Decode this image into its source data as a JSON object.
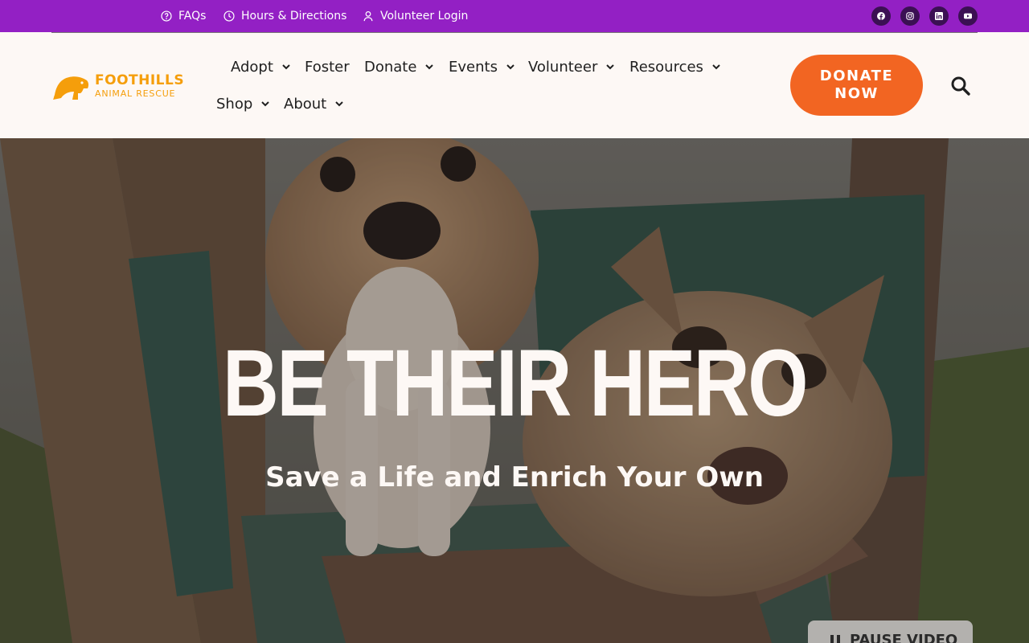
{
  "topbar": {
    "links": [
      {
        "label": "FAQs",
        "icon": "question-circle-icon"
      },
      {
        "label": "Hours & Directions",
        "icon": "clock-icon"
      },
      {
        "label": "Volunteer Login",
        "icon": "user-icon"
      }
    ],
    "social": [
      "facebook-icon",
      "instagram-icon",
      "linkedin-icon",
      "youtube-icon"
    ],
    "color": "#9320c4"
  },
  "logo": {
    "top": "FOOTHILLS",
    "bottom": "ANIMAL RESCUE",
    "color": "#f59e0b"
  },
  "nav": {
    "items": [
      {
        "label": "Adopt",
        "dropdown": true
      },
      {
        "label": "Foster",
        "dropdown": false
      },
      {
        "label": "Donate",
        "dropdown": true
      },
      {
        "label": "Events",
        "dropdown": true
      },
      {
        "label": "Volunteer",
        "dropdown": true
      },
      {
        "label": "Resources",
        "dropdown": true
      },
      {
        "label": "Shop",
        "dropdown": true
      },
      {
        "label": "About",
        "dropdown": true
      }
    ]
  },
  "donate": {
    "line1": "DONATE",
    "line2": "NOW",
    "color": "#f26522"
  },
  "search": {
    "icon": "search-icon"
  },
  "hero": {
    "title": "BE THEIR HERO",
    "subtitle": "Save a Life and Enrich Your Own",
    "pause_label": "PAUSE VIDEO"
  }
}
